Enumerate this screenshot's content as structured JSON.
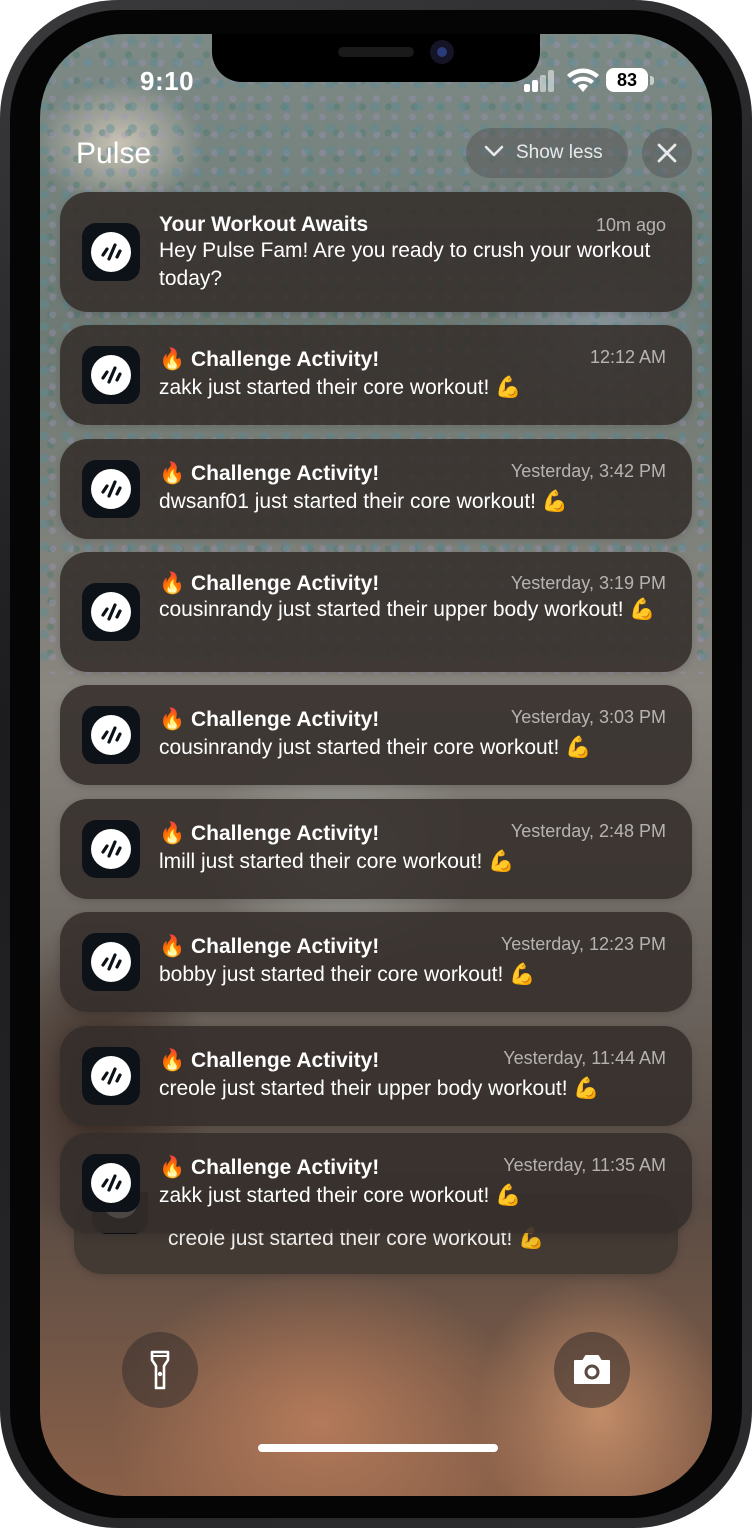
{
  "status_bar": {
    "time": "9:10",
    "battery": "83"
  },
  "header": {
    "app_name": "Pulse",
    "show_less_label": "Show less"
  },
  "notifications": [
    {
      "title": "Your Workout Awaits",
      "time": "10m ago",
      "body": "Hey Pulse Fam! Are you ready to crush your workout today?"
    },
    {
      "title": "🔥 Challenge Activity!",
      "time": "12:12 AM",
      "body": "zakk just started their core workout! 💪"
    },
    {
      "title": "🔥 Challenge Activity!",
      "time": "Yesterday, 3:42 PM",
      "body": "dwsanf01 just started their core workout! 💪"
    },
    {
      "title": "🔥 Challenge Activity!",
      "time": "Yesterday, 3:19 PM",
      "body": "cousinrandy just started their upper body workout! 💪"
    },
    {
      "title": "🔥 Challenge Activity!",
      "time": "Yesterday, 3:03 PM",
      "body": "cousinrandy just started their core workout! 💪"
    },
    {
      "title": "🔥 Challenge Activity!",
      "time": "Yesterday, 2:48 PM",
      "body": "lmill just started their core workout! 💪"
    },
    {
      "title": "🔥 Challenge Activity!",
      "time": "Yesterday, 12:23 PM",
      "body": "bobby just started their core workout! 💪"
    },
    {
      "title": "🔥 Challenge Activity!",
      "time": "Yesterday, 11:44 AM",
      "body": "creole just started their upper body workout! 💪"
    },
    {
      "title": "🔥 Challenge Activity!",
      "time": "Yesterday, 11:35 AM",
      "body": "zakk just started their core workout! 💪"
    }
  ],
  "stacked_notification": {
    "body": "creole just started their core workout! 💪"
  },
  "icons": {
    "app_icon": "pulse-waveform-icon",
    "flashlight": "flashlight-icon",
    "camera": "camera-icon"
  },
  "colors": {
    "notification_bg": "#342e2a",
    "app_icon_bg": "#0c1218",
    "text_primary": "#ffffff"
  }
}
